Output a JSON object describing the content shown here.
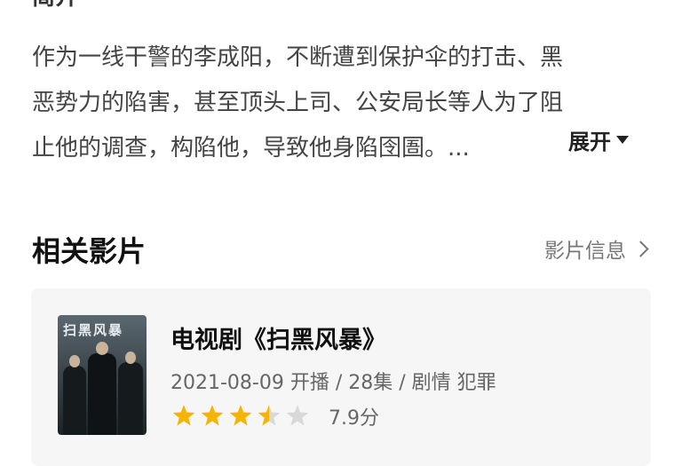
{
  "summary": {
    "lines": [
      "作为一线干警的李成阳，不断遭到保护伞的打击、黑",
      "恶势力的陷害，甚至顶头上司、公安局长等人为了阻",
      "止他的调查，构陷他，导致他身陷囹圄。..."
    ],
    "expand_label": "展开"
  },
  "related": {
    "title": "相关影片",
    "link_label": "影片信息",
    "item": {
      "title": "电视剧《扫黑风暴》",
      "meta": "2021-08-09 开播 / 28集 / 剧情 犯罪",
      "rating": 3.5,
      "rating_max": 5,
      "score": "7.9分",
      "poster_title": "扫黑风暴",
      "star_color": "#f5b400",
      "star_empty_color": "#d8d8d8"
    }
  }
}
